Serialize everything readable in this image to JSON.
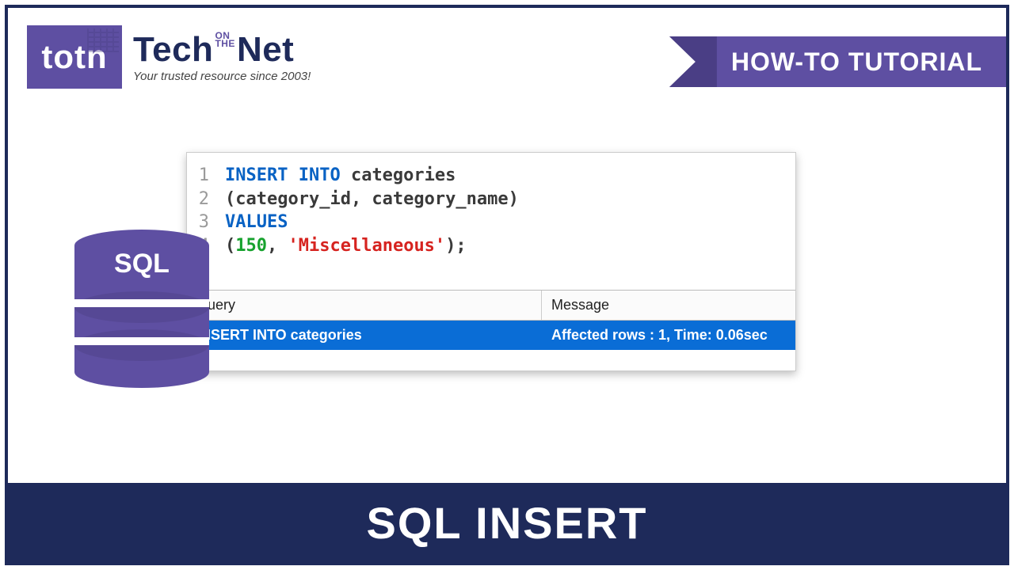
{
  "logo": {
    "badge": "totn",
    "line1_a": "Tech",
    "line1_sup_top": "ON",
    "line1_sup_bot": "THE",
    "line1_b": "Net",
    "tagline": "Your trusted resource since 2003!"
  },
  "ribbon": {
    "label": "HOW-TO TUTORIAL"
  },
  "code": {
    "lines": [
      {
        "n": "1",
        "parts": [
          {
            "cls": "kw",
            "t": "INSERT INTO"
          },
          {
            "cls": "txt",
            "t": " categories"
          }
        ]
      },
      {
        "n": "2",
        "parts": [
          {
            "cls": "txt",
            "t": "(category_id, category_name)"
          }
        ]
      },
      {
        "n": "3",
        "parts": [
          {
            "cls": "kw",
            "t": "VALUES"
          }
        ]
      },
      {
        "n": "4",
        "parts": [
          {
            "cls": "txt",
            "t": "("
          },
          {
            "cls": "num",
            "t": "150"
          },
          {
            "cls": "txt",
            "t": ", "
          },
          {
            "cls": "str",
            "t": "'Miscellaneous'"
          },
          {
            "cls": "txt",
            "t": ");"
          }
        ]
      }
    ]
  },
  "results": {
    "head": {
      "c1": "Query",
      "c2": "Message"
    },
    "row": {
      "c1": "INSERT INTO categories",
      "c2": "Affected rows : 1, Time: 0.06sec"
    }
  },
  "db_label": "SQL",
  "footer": "SQL INSERT"
}
